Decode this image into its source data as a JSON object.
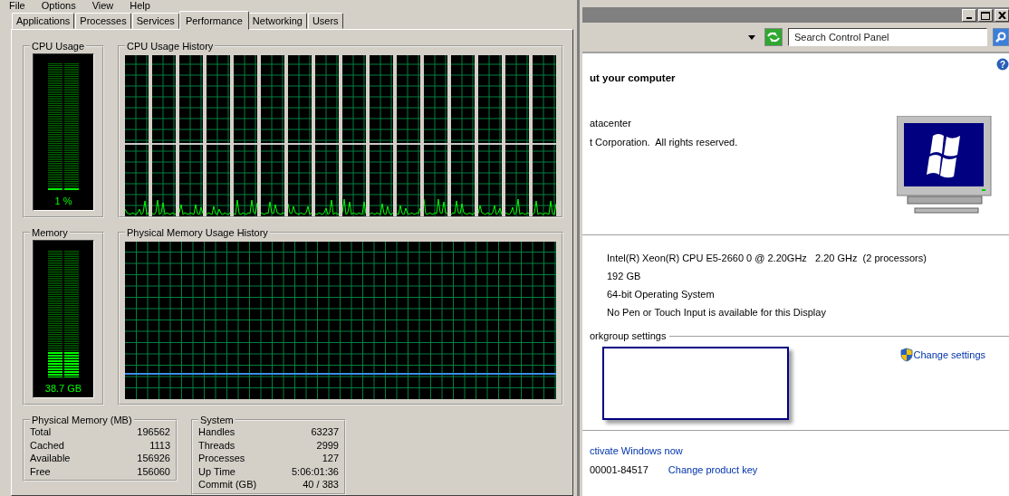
{
  "task_manager": {
    "menu": [
      "File",
      "Options",
      "View",
      "Help"
    ],
    "tabs": [
      {
        "label": "Applications",
        "selected": false
      },
      {
        "label": "Processes",
        "selected": false
      },
      {
        "label": "Services",
        "selected": false
      },
      {
        "label": "Performance",
        "selected": true
      },
      {
        "label": "Networking",
        "selected": false
      },
      {
        "label": "Users",
        "selected": false
      }
    ],
    "cpu_usage": {
      "title": "CPU Usage",
      "level": 0.01,
      "reading": "1 %"
    },
    "cpu_history": {
      "title": "CPU Usage History"
    },
    "memory": {
      "title": "Memory",
      "level": 0.2,
      "reading": "38.7 GB"
    },
    "memory_history": {
      "title": "Physical Memory Usage History"
    },
    "physical_memory": {
      "title": "Physical Memory (MB)",
      "rows": [
        {
          "label": "Total",
          "value": "196562"
        },
        {
          "label": "Cached",
          "value": "1113"
        },
        {
          "label": "Available",
          "value": "156926"
        },
        {
          "label": "Free",
          "value": "156060"
        }
      ]
    },
    "system": {
      "title": "System",
      "rows": [
        {
          "label": "Handles",
          "value": "63237"
        },
        {
          "label": "Threads",
          "value": "2999"
        },
        {
          "label": "Processes",
          "value": "127"
        },
        {
          "label": "Up Time",
          "value": "5:06:01:36"
        },
        {
          "label": "Commit (GB)",
          "value": "40 / 383"
        }
      ]
    }
  },
  "control_panel": {
    "help": "?",
    "search": {
      "placeholder": "Search Control Panel"
    },
    "heading": "ut your computer",
    "edition": "atacenter",
    "copyright": "t Corporation.  All rights reserved.",
    "system_info": [
      "Intel(R) Xeon(R) CPU E5-2660 0 @ 2.20GHz   2.20 GHz  (2 processors)",
      "192 GB",
      "64-bit Operating System",
      "No Pen or Touch Input is available for this Display"
    ],
    "workgroup": {
      "title": "orkgroup settings",
      "link": "Change settings"
    },
    "activation": {
      "link": "ctivate Windows now",
      "product_id": "00001-84517",
      "change_key": "Change product key"
    }
  }
}
